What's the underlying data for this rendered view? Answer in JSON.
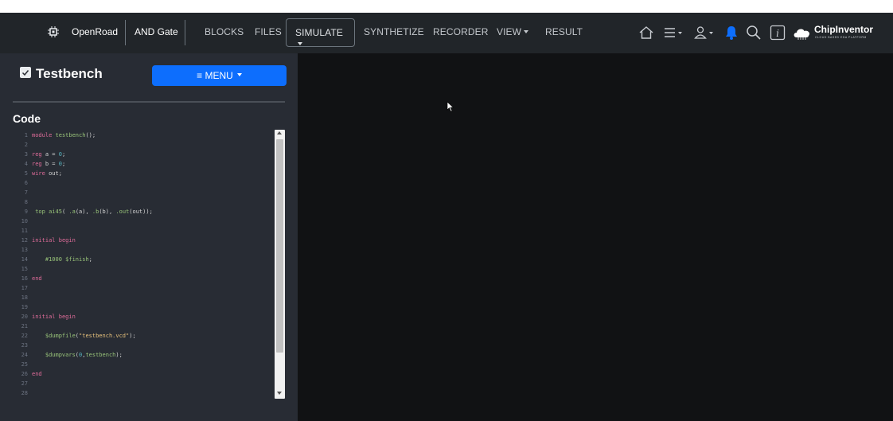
{
  "navbar": {
    "project": "OpenRoad",
    "design": "AND Gate",
    "links": [
      {
        "label": "BLOCKS",
        "caret": false
      },
      {
        "label": "FILES",
        "caret": false
      },
      {
        "label": "SIMULATE",
        "caret": true,
        "active": true
      },
      {
        "label": "SYNTHETIZE",
        "caret": false
      },
      {
        "label": "RECORDER",
        "caret": false
      },
      {
        "label": "VIEW",
        "caret": true
      },
      {
        "label": "RESULT",
        "caret": false
      }
    ],
    "icons": [
      "home-icon",
      "hamburger-menu-icon",
      "user-icon",
      "bell-icon",
      "search-icon",
      "info-icon"
    ],
    "logo": {
      "name": "ChipInventor",
      "tagline": "CLOUD BASED EDA PLATFORM"
    },
    "accent": "#0d6efd"
  },
  "sidebar": {
    "title": "Testbench",
    "menu_label": "≡ MENU",
    "code_label": "Code"
  },
  "editor": {
    "lines": [
      {
        "n": "1",
        "text": "module testbench();"
      },
      {
        "n": "2",
        "text": ""
      },
      {
        "n": "3",
        "text": "reg a = 0;"
      },
      {
        "n": "4",
        "text": "reg b = 0;"
      },
      {
        "n": "5",
        "text": "wire out;"
      },
      {
        "n": "6",
        "text": ""
      },
      {
        "n": "7",
        "text": ""
      },
      {
        "n": "8",
        "text": ""
      },
      {
        "n": "9",
        "text": " top ai45( .a(a), .b(b), .out(out));"
      },
      {
        "n": "10",
        "text": ""
      },
      {
        "n": "11",
        "text": ""
      },
      {
        "n": "12",
        "text": "initial begin"
      },
      {
        "n": "13",
        "text": ""
      },
      {
        "n": "14",
        "text": "    #1000 $finish;"
      },
      {
        "n": "15",
        "text": ""
      },
      {
        "n": "16",
        "text": "end"
      },
      {
        "n": "17",
        "text": ""
      },
      {
        "n": "18",
        "text": ""
      },
      {
        "n": "19",
        "text": ""
      },
      {
        "n": "20",
        "text": "initial begin"
      },
      {
        "n": "21",
        "text": ""
      },
      {
        "n": "22",
        "text": "    $dumpfile(\"testbench.vcd\");"
      },
      {
        "n": "23",
        "text": ""
      },
      {
        "n": "24",
        "text": "    $dumpvars(0,testbench);"
      },
      {
        "n": "25",
        "text": ""
      },
      {
        "n": "26",
        "text": "end"
      },
      {
        "n": "27",
        "text": ""
      },
      {
        "n": "28",
        "text": ""
      }
    ]
  }
}
